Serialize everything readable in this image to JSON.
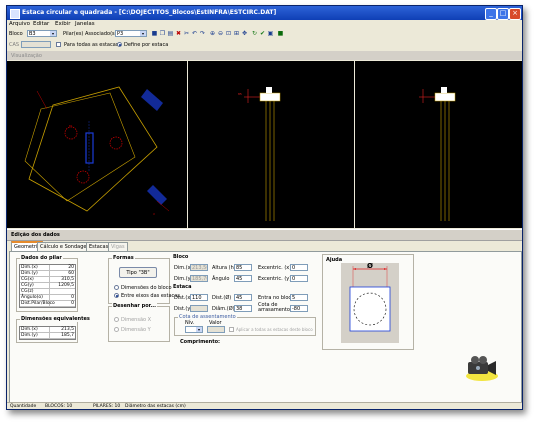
{
  "window": {
    "title": "Estaca circular e quadrada - [C:\\DOJECTTOS_Blocos\\EstINFRA\\ESTCIRC.DAT]"
  },
  "menu": [
    "Arquivo",
    "Editar",
    "Exibir",
    "Janelas"
  ],
  "toolbar": {
    "bloco_label": "Bloco",
    "bloco_value": "B3",
    "pilar_label": "Pilar(es) Associado(s)",
    "pilar_value": "P3",
    "buttons": [
      "save",
      "copy",
      "paste",
      "delete",
      "cut",
      "undo",
      "redo",
      "zoom-in",
      "zoom-out",
      "zoom-window",
      "zoom-all",
      "pan",
      "refresh",
      "check",
      "preview",
      "exit"
    ]
  },
  "row3": {
    "cas_label": "CAS",
    "cas_value": "",
    "opt1_label": "Para todas as estacas",
    "opt1_checked": false,
    "opt2_label": "Define por estaca",
    "opt2_checked": true
  },
  "visualizacao": {
    "header": "Visualização"
  },
  "edicao": {
    "title": "Edição dos dados",
    "tabs": [
      {
        "label": "Geometria",
        "state": "active"
      },
      {
        "label": "Cálculo e Sondagem",
        "state": "normal"
      },
      {
        "label": "Estacas",
        "state": "normal"
      },
      {
        "label": "Vigas",
        "state": "disabled"
      }
    ]
  },
  "pilar": {
    "title": "Dados do pilar",
    "rows": [
      {
        "k": "Dim.(x)",
        "v": "20"
      },
      {
        "k": "Dim.(y)",
        "v": "60"
      },
      {
        "k": "CG(x)",
        "v": "310,5"
      },
      {
        "k": "CG(y)",
        "v": "1209,5"
      },
      {
        "k": "CG(z)",
        "v": ""
      },
      {
        "k": "Ângulo(o)",
        "v": "0"
      },
      {
        "k": "Dist.Pilar/Bloco",
        "v": "0"
      }
    ]
  },
  "dim_equiv": {
    "title": "Dimensões equivalentes",
    "rows": [
      {
        "k": "Dim.(x)",
        "v": "213,5"
      },
      {
        "k": "Dim.(y)",
        "v": "185,7"
      }
    ]
  },
  "formas": {
    "title": "Formas",
    "tipo_button": "Tipo \"3B\"",
    "opt1": "Dimensões do bloco",
    "opt2": "Entre eixos das estacas"
  },
  "desenhar": {
    "title": "Desenhar por...",
    "opt1": "Dimensão X",
    "opt2": "Dimensão Y"
  },
  "bloco": {
    "title": "Bloco",
    "dimx_label": "Dim.(x)",
    "dimx_value": "213,50",
    "altura_label": "Altura (h)",
    "altura_value": "85",
    "excx_label": "Excentric. (x)",
    "excx_value": "0",
    "dimy_label": "Dim.(y)",
    "dimy_value": "185,70",
    "angulo_label": "Ângulo",
    "angulo_value": "45",
    "excy_label": "Excentric. (y)",
    "excy_value": "0"
  },
  "estaca": {
    "title": "Estaca",
    "distx_label": "Dist.(x)",
    "distx_value": "110",
    "diam_phi_label": "Dist.(Ø)",
    "diam_phi_value": "45",
    "entra_label": "Entra no bloco",
    "entra_value": "5",
    "disty_label": "Dist.(y)",
    "disty_value": "",
    "diam_label": "Diâm.(Ø)",
    "diam_value": "38",
    "cota_arras_label": "Cota de arrasamento",
    "cota_arras_value": "-80"
  },
  "cota": {
    "title": "Cota de assentamento",
    "nivel_label": "Nív.",
    "valor_label": "Valor",
    "aplicar_label": "Aplicar a todas as estacas deste bloco",
    "comprimento_label": "Comprimento:"
  },
  "ajuda": {
    "title": "Ajuda",
    "diam_symbol": "Ø"
  },
  "status": {
    "quantidade": "Quantidade",
    "blocos": "BLOCOS: 10",
    "pilares": "PILARES: 10",
    "hint": "Diâmetro das estacas (cm)"
  },
  "colors": {
    "viewport_bg": "#000000",
    "bloco_outline": "#c8a000",
    "pilar": "#1a3cd8",
    "estaca": "#c00000",
    "cota": "#e02020",
    "titlebar": "#1c4fc7"
  }
}
